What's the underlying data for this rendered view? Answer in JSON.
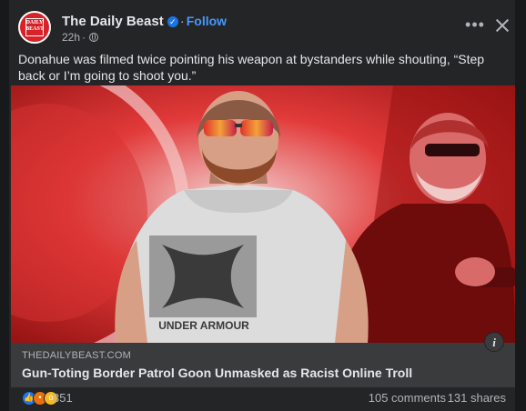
{
  "post": {
    "page_name": "The Daily Beast",
    "follow_label": "Follow",
    "time": "22h",
    "avatar_logo_text": "DAILY BEAST",
    "text": "Donahue was filmed twice pointing his weapon at bystanders while shouting, “Step back or I’m going to shoot you.”"
  },
  "photo": {
    "shirt_text": "UNDER ARMOUR"
  },
  "link": {
    "domain": "THEDAILYBEAST.COM",
    "headline": "Gun-Toting Border Patrol Goon Unmasked as Racist Online Troll",
    "info_label": "i"
  },
  "footer": {
    "reaction_count": "351",
    "comments": "105 comments",
    "shares": "131 shares"
  },
  "icons": {
    "more": "more-options-icon",
    "close": "close-icon",
    "verified": "verified-badge-icon",
    "globe": "globe-icon",
    "info": "info-icon",
    "reactions": [
      "like-icon",
      "angry-icon",
      "wow-icon"
    ]
  },
  "colors": {
    "card_bg": "#242526",
    "page_bg": "#18191a",
    "follow": "#4599ff",
    "link_bg": "#3a3b3c",
    "brand_red": "#d8222a"
  }
}
